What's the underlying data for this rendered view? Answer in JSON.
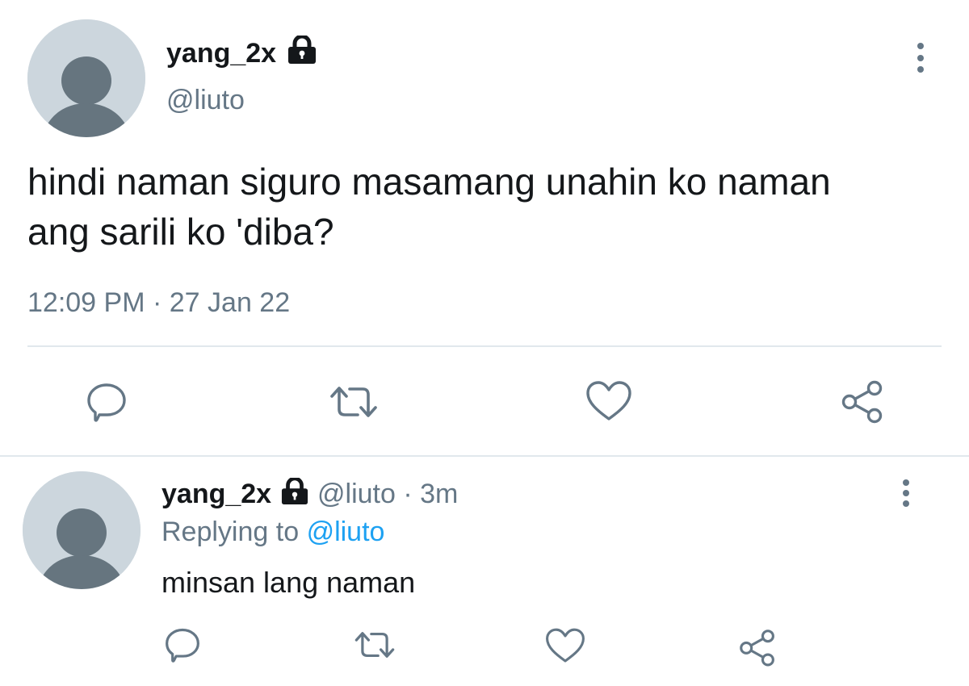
{
  "main_tweet": {
    "display_name": "yang_2x",
    "handle": "@liuto",
    "text_line1": "hindi naman siguro masamang unahin ko naman",
    "text_line2": "ang sarili ko 'diba?",
    "time": "12:09 PM",
    "separator": "·",
    "date": "27 Jan 22",
    "actions": [
      "reply",
      "retweet",
      "like",
      "share"
    ]
  },
  "reply_tweet": {
    "display_name": "yang_2x",
    "handle": "@liuto",
    "separator": "·",
    "age": "3m",
    "replying_label": "Replying to",
    "replying_handle": "@liuto",
    "text": "minsan lang naman",
    "actions": [
      "reply",
      "retweet",
      "like",
      "share"
    ]
  },
  "colors": {
    "muted": "#657786",
    "link": "#1da1f2",
    "avatar_bg": "#ccd6dd",
    "avatar_fg": "#66757f",
    "divider": "#e1e8ed"
  },
  "icons": {
    "protected": "lock-icon",
    "more": "more-vertical-icon",
    "reply": "speech-bubble-icon",
    "retweet": "retweet-arrows-icon",
    "like": "heart-icon",
    "share": "share-nodes-icon"
  }
}
